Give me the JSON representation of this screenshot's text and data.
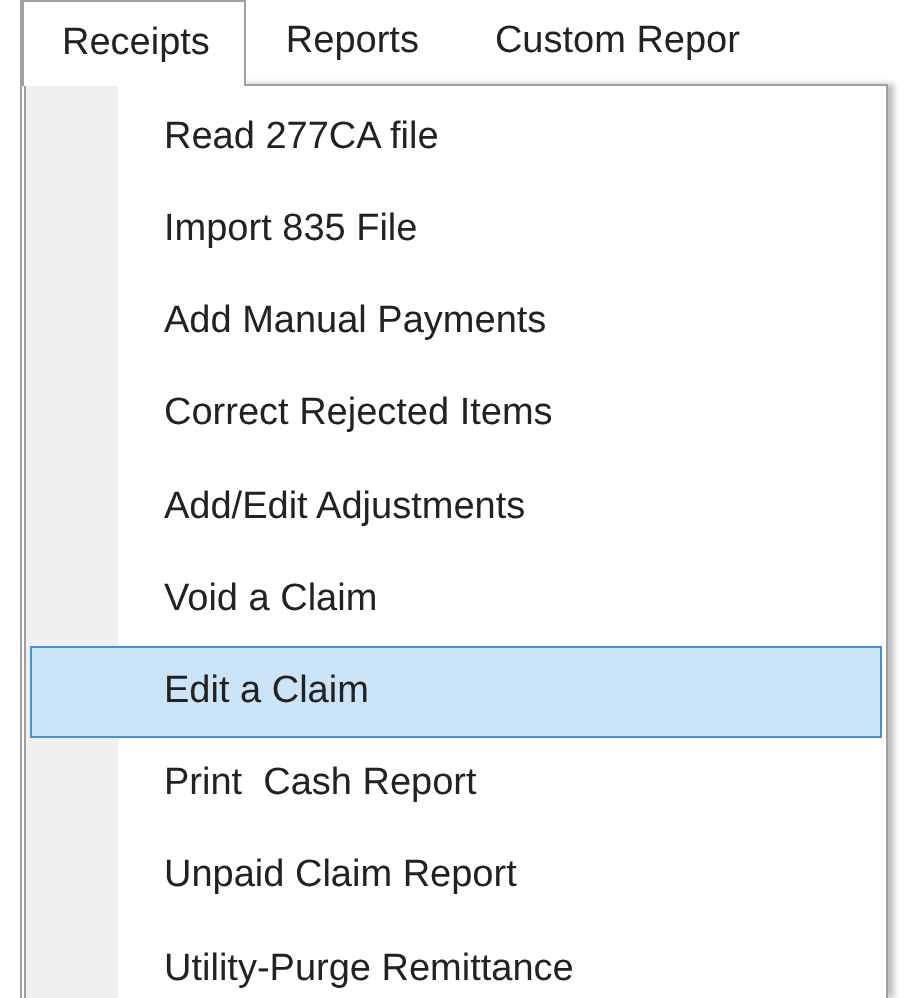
{
  "menu_bar": [
    {
      "label": "Receipts",
      "selected": true
    },
    {
      "label": "Reports",
      "selected": false
    },
    {
      "label": "Custom Repor",
      "selected": false
    }
  ],
  "menu_items": [
    {
      "label": "Read 277CA file",
      "selected": false
    },
    {
      "label": "Import 835 File",
      "selected": false
    },
    {
      "label": "Add Manual Payments",
      "selected": false
    },
    {
      "label": "Correct Rejected Items",
      "selected": false
    },
    {
      "label": "Add/Edit Adjustments",
      "selected": false
    },
    {
      "label": "Void a Claim",
      "selected": false
    },
    {
      "label": "Edit a Claim",
      "selected": true
    },
    {
      "label": "Print  Cash Report",
      "selected": false
    },
    {
      "label": "Unpaid Claim Report",
      "selected": false
    },
    {
      "label": "Utility-Purge Remittance",
      "selected": false
    }
  ]
}
